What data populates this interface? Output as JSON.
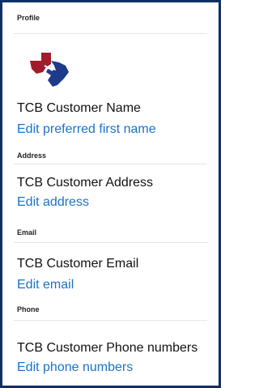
{
  "sections": {
    "profile": {
      "label": "Profile",
      "name": "TCB Customer Name",
      "link": "Edit preferred first name"
    },
    "address": {
      "label": "Address",
      "value": "TCB Customer Address",
      "link": "Edit address"
    },
    "email": {
      "label": "Email",
      "value": "TCB Customer Email",
      "link": "Edit email"
    },
    "phone": {
      "label": "Phone",
      "value": "TCB Customer Phone numbers",
      "link": "Edit phone numbers"
    }
  },
  "colors": {
    "border": "#0f2f66",
    "link": "#1a73c7",
    "logo_red": "#a01c2a",
    "logo_blue": "#1e3a8a"
  },
  "icons": {
    "profile_logo": "texas-map-logo"
  }
}
